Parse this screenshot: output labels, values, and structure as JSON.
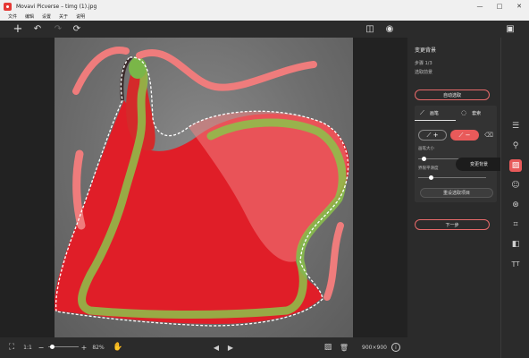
{
  "window": {
    "title": "Movavi Picverse – timg (1).jpg",
    "minimize": "—",
    "maximize": "□",
    "close": "✕"
  },
  "menu": [
    "文件",
    "编辑",
    "设置",
    "关于",
    "说明"
  ],
  "toolbar": {
    "add_icon": "+",
    "undo_icon": "↶",
    "redo_icon": "↷",
    "reset_icon": "⟳",
    "compare_icon": "◫",
    "preview_icon": "◉",
    "save_icon": "▣"
  },
  "panel": {
    "title": "变更背景",
    "step": "步骤 1/3",
    "step_desc": "选取前景",
    "auto_select": "自动选取",
    "tab_brush": "画笔",
    "tab_lasso": "套索",
    "brush_size_label": "画笔大小",
    "brush_hardness_label": "界限平滑度",
    "reset_selection": "重设选取项目",
    "next_step": "下一步"
  },
  "tooltip": "变更背景",
  "bottombar": {
    "fullscreen_icon": "⛶",
    "ratio": "1:1",
    "zoom_out_icon": "−",
    "zoom_in_icon": "+",
    "zoom": "82%",
    "zoom_level": 0.3,
    "prev_icon": "◀",
    "next_icon": "▶",
    "image_icon": "▨",
    "delete_icon": "🗑",
    "dimensions": "900×900",
    "info_icon": "i"
  },
  "rail": [
    "adjust",
    "stamp",
    "change-background",
    "face",
    "filters",
    "crop",
    "layers",
    "text"
  ],
  "colors": {
    "accent": "#e85a5a",
    "keep_brush": "#8bc34a",
    "remove_brush": "#ef7c7c",
    "dress": "#e01e28"
  }
}
